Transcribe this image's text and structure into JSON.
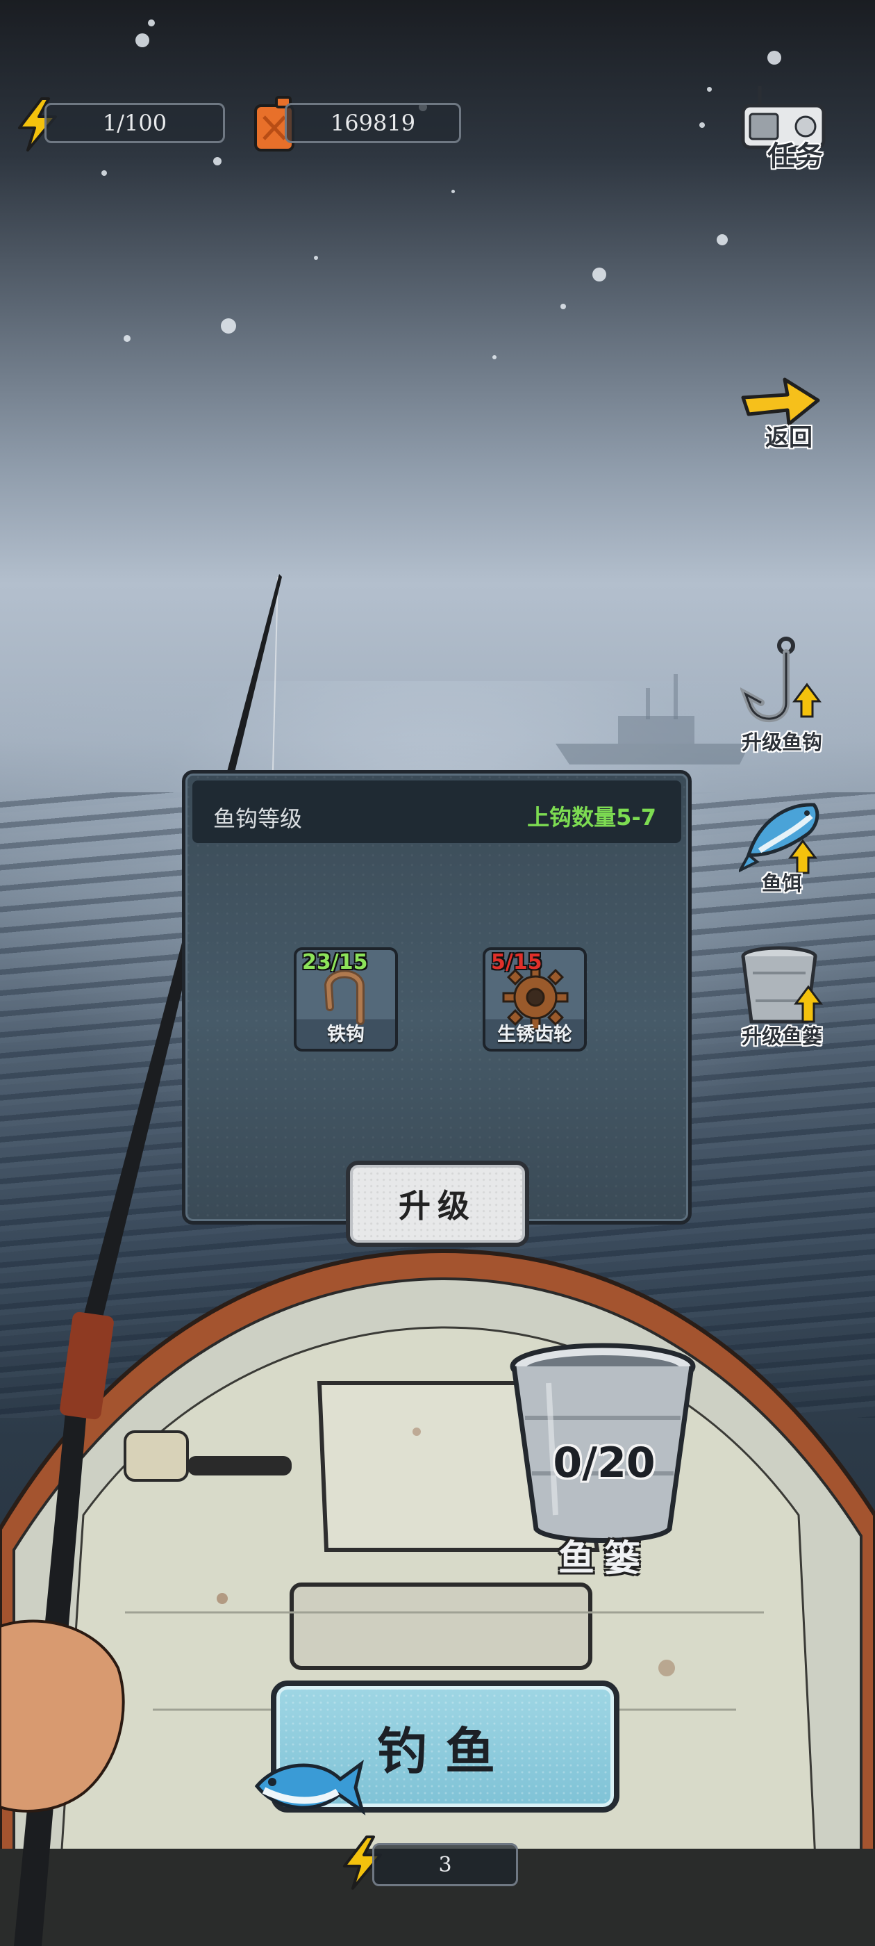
{
  "hud": {
    "energy": "1/100",
    "fuel": "169819"
  },
  "side_menu": {
    "task_label": "任务",
    "back_label": "返回",
    "upgrade_hook_label": "升级鱼钩",
    "bait_label": "鱼饵",
    "upgrade_basket_label": "升级鱼篓"
  },
  "hook_panel": {
    "title": "鱼钩等级",
    "hook_count_label": "上钩数量5-7",
    "materials": [
      {
        "name": "铁钩",
        "count": "23/15",
        "count_color": "#8de35a",
        "icon": "iron-hook-icon"
      },
      {
        "name": "生锈齿轮",
        "count": "5/15",
        "count_color": "#e0302a",
        "icon": "rusty-gear-icon"
      }
    ],
    "upgrade_label": "升级"
  },
  "basket": {
    "capacity": "0/20",
    "label": "鱼篓"
  },
  "fishing": {
    "button_label": "钓鱼",
    "energy_cost": "3"
  },
  "colors": {
    "accent_green": "#7ddc52",
    "energy_yellow": "#f4c20d",
    "fuel_orange": "#e8702a"
  }
}
